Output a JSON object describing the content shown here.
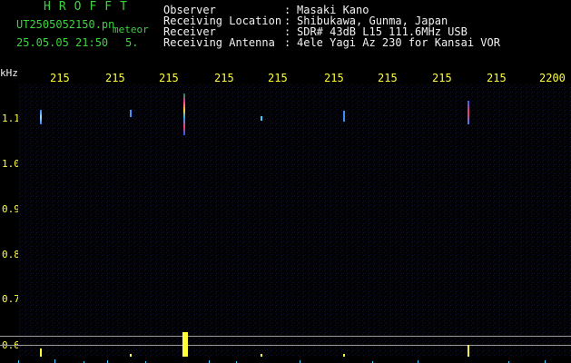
{
  "header": {
    "brand": "HROFFT",
    "filename": "UT2505052150.pn",
    "meteor_tag": "meteor",
    "datetime": "25.05.05 21:50",
    "count": "5.",
    "fields": [
      {
        "label": "Observer",
        "value": "Masaki Kano"
      },
      {
        "label": "Receiving Location",
        "value": "Shibukawa, Gunma, Japan"
      },
      {
        "label": "Receiver",
        "value": "SDR# 43dB L15 111.6MHz USB"
      },
      {
        "label": "Receiving Antenna",
        "value": "4ele Yagi Az 230 for Kansai VOR"
      }
    ],
    "colon": ":"
  },
  "axes": {
    "y_unit": "kHz",
    "x_ticks": [
      "215",
      "215",
      "215",
      "215",
      "215",
      "215",
      "215",
      "215",
      "215",
      "2200"
    ],
    "y_ticks": [
      "1.1",
      "1.0",
      "0.9",
      "0.8",
      "0.7",
      "0.6"
    ]
  },
  "colors": {
    "header_green": "#3fd23f",
    "tick_yellow": "#ffff3a",
    "text_white": "#f2f2f2",
    "background": "#000000"
  }
}
